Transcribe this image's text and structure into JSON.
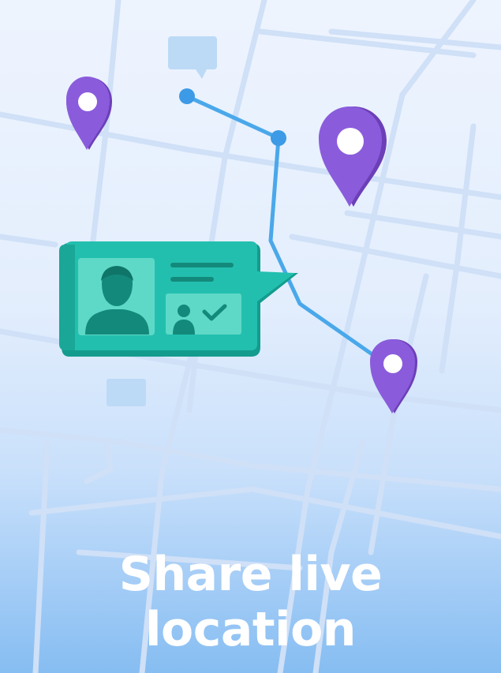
{
  "headline": {
    "line1": "Share live",
    "line2": "location"
  },
  "colors": {
    "background_top": "#eef4fe",
    "background_bottom": "#86bdf2",
    "map_roads": "#cfe0f7",
    "route": "#4aa8ea",
    "pin": "#8a5cdc",
    "card": "#22bfae",
    "card_panel": "#5ed9c7",
    "headline_text": "#ffffff"
  },
  "icons": {
    "pins": [
      "map-pin-icon",
      "map-pin-icon",
      "map-pin-icon"
    ],
    "profile": "person-silhouette-icon",
    "verified": "checkmark-icon",
    "map_labels": [
      "speech-bubble-icon",
      "map-label-icon"
    ]
  }
}
